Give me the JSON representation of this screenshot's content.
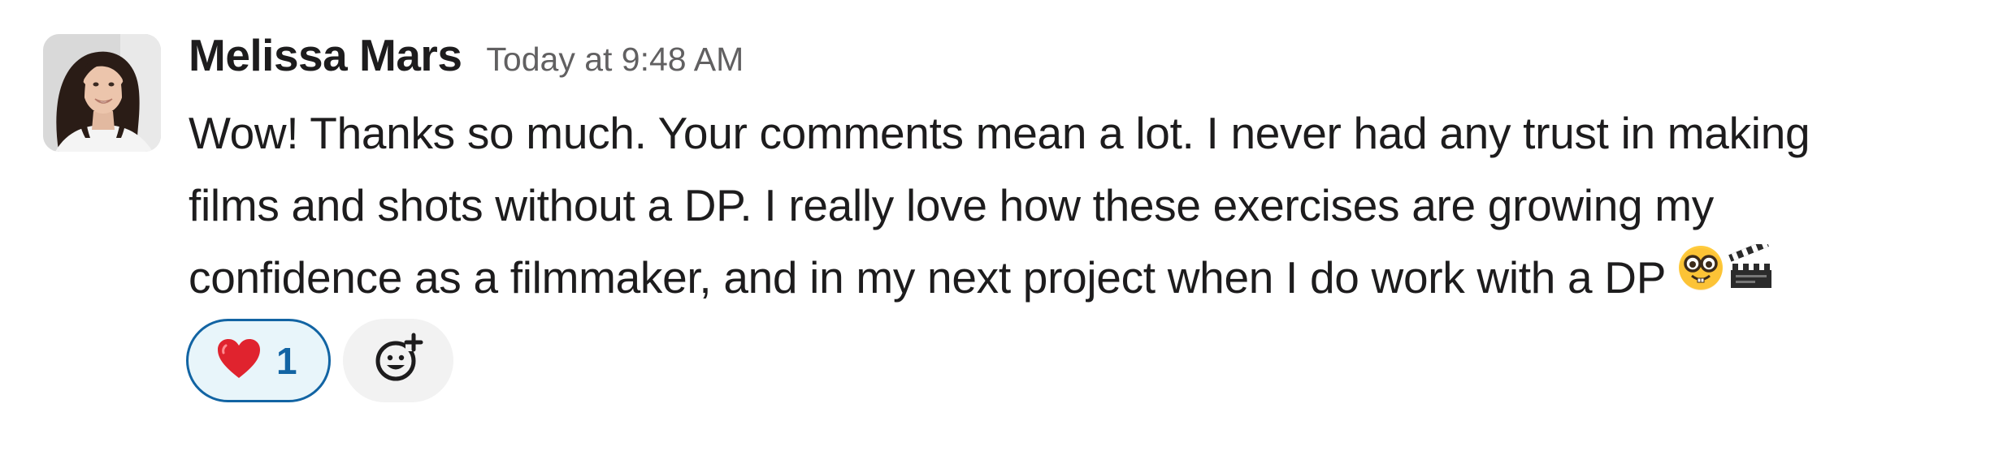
{
  "message": {
    "author": "Melissa Mars",
    "timestamp": "Today at 9:48 AM",
    "body_lines": [
      "Wow! Thanks so much. Your comments mean a lot. I never had any trust in making",
      "films and shots without a DP. I really love how these exercises are growing my",
      "confidence as a filmmaker, and in my next project when I do work with a DP"
    ],
    "trailing_emojis": [
      "nerd-face-emoji",
      "clapper-board-emoji"
    ]
  },
  "reactions": [
    {
      "emoji": "red-heart-emoji",
      "count": "1",
      "reacted_by_me": true
    }
  ],
  "add_reaction": {
    "icon": "add-emoji-icon"
  },
  "colors": {
    "text": "#1d1c1d",
    "timestamp": "#616061",
    "reaction_border": "#1264a3",
    "reaction_bg": "#e8f5fa",
    "add_reaction_bg": "#f2f2f2"
  }
}
